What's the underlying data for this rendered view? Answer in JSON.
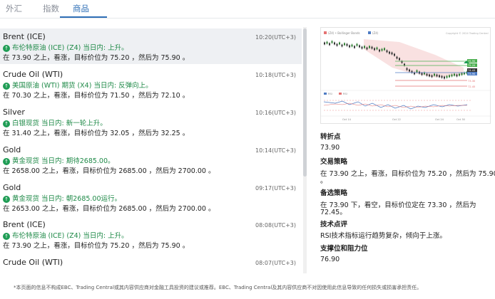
{
  "tabs": [
    {
      "label": "外汇"
    },
    {
      "label": "指数"
    },
    {
      "label": "商品"
    }
  ],
  "feed": [
    {
      "title": "Brent (ICE)",
      "time": "10:20(UTC+3)",
      "headline": "布伦特原油 (ICE) (Z4) 当日内: 上升。",
      "detail": "在 73.90 之上，看涨，目标价位为 75.20 ，然后为 75.90 。"
    },
    {
      "title": "Crude Oil (WTI)",
      "time": "10:18(UTC+3)",
      "headline": "美国原油 (WTI) 期货 (X4) 当日内: 反弹向上。",
      "detail": "在 70.30 之上，看涨，目标价位为 71.50 ，然后为 72.10 。"
    },
    {
      "title": "Silver",
      "time": "10:16(UTC+3)",
      "headline": "白银现货 当日内: 新一轮上升。",
      "detail": "在 31.40 之上，看涨，目标价位为 32.05 ，然后为 32.25 。"
    },
    {
      "title": "Gold",
      "time": "10:14(UTC+3)",
      "headline": "黄金现货 当日内: 期待2685.00。",
      "detail": "在 2658.00 之上，看涨，目标价位为 2685.00 ，然后为 2700.00 。"
    },
    {
      "title": "Gold",
      "time": "09:17(UTC+3)",
      "headline": "黄金现货 当日内: 朝2685.00运行。",
      "detail": "在 2653.00 之上，看涨，目标价位为 2685.00 ，然后为 2700.00 。"
    },
    {
      "title": "Brent (ICE)",
      "time": "08:08(UTC+3)",
      "headline": "布伦特原油 (ICE) (Z4) 当日内: 上升。",
      "detail": "在 73.90 之上，看涨，目标价位为 75.20 ，然后为 75.90 。"
    },
    {
      "title": "Crude Oil (WTI)",
      "time": "08:07(UTC+3)",
      "headline": "",
      "detail": ""
    }
  ],
  "chart": {
    "legend_main": "(Z4) • Bollinger Bands",
    "legend_second": "(Z4)",
    "copyright": "Copyright © 2024 Trading Central",
    "price_labels": [
      "75.90",
      "75.20",
      "74.43",
      "73.90",
      "73.30",
      "72.45"
    ],
    "rsi_legend": [
      "RSI",
      "RSI"
    ],
    "x_ticks": [
      "Oct 14",
      "Oct 22",
      "Oct 24",
      "Oct 30"
    ],
    "colors": {
      "candle_up": "#2e7d32",
      "candle_down": "#333333",
      "resistance": "#4caf50",
      "support": "#e57373",
      "band": "#f4c9c9",
      "ma": "#4f7cc4"
    }
  },
  "side": {
    "pivot_label": "转折点",
    "pivot_value": "73.90",
    "strategy_label": "交易策略",
    "strategy_line1": "在 73.90 之上，看涨，目标价位为 75.20 ，然后为 75.90",
    "strategy_line2": "。",
    "alt_label": "备选策略",
    "alt_line1": "在 73.90 下，看空，目标价位定在 73.30 ，然后为",
    "alt_line2": "72.45。",
    "comment_label": "技术点评",
    "comment_text": "RSI技术指标运行趋势复杂，倾向于上涨。",
    "sr_label": "支撑位和阻力位",
    "sr_value": "76.90"
  },
  "disclaimer": "*本页面的信息不构成EBC、Trading Central或其内容供应商对金融工具投资的建议或推荐。EBC、Trading Central及其内容供应商不对因使用此信息导致的任何损失或损害承担责任。"
}
